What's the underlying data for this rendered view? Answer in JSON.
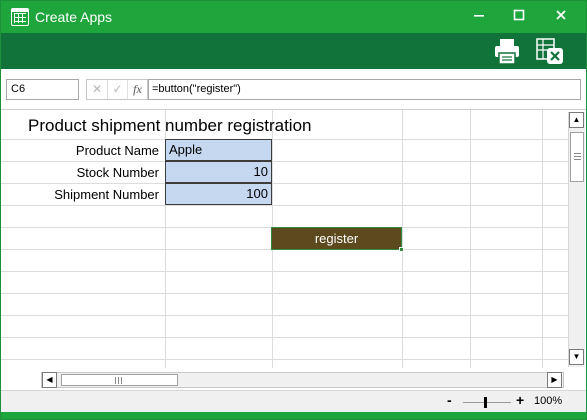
{
  "window": {
    "title": "Create Apps",
    "minimize_label": "—",
    "maximize_label": "☐",
    "close_label": "✕"
  },
  "toolbar": {
    "icons": [
      "printer-icon",
      "export-excel-icon"
    ]
  },
  "formula_bar": {
    "name_box": "C6",
    "cancel_glyph": "✕",
    "enter_glyph": "✓",
    "fx_glyph": "fx",
    "formula": "=button(\"register\")"
  },
  "sheet": {
    "title": "Product shipment number registration",
    "rows": [
      {
        "label": "Product Name",
        "value": "Apple"
      },
      {
        "label": "Stock Number",
        "value": "10"
      },
      {
        "label": "Shipment Number",
        "value": "100"
      }
    ],
    "button_label": "register"
  },
  "scrollbars": {
    "up": "▲",
    "down": "▼",
    "left": "◀",
    "right": "▶"
  },
  "status": {
    "zoom_minus": "-",
    "zoom_plus": "+",
    "zoom_level": "100%"
  },
  "colors": {
    "title_bar": "#1ea63d",
    "toolbar": "#12733a",
    "input_cell": "#c6d8f0",
    "button": "#5c4a1e"
  }
}
